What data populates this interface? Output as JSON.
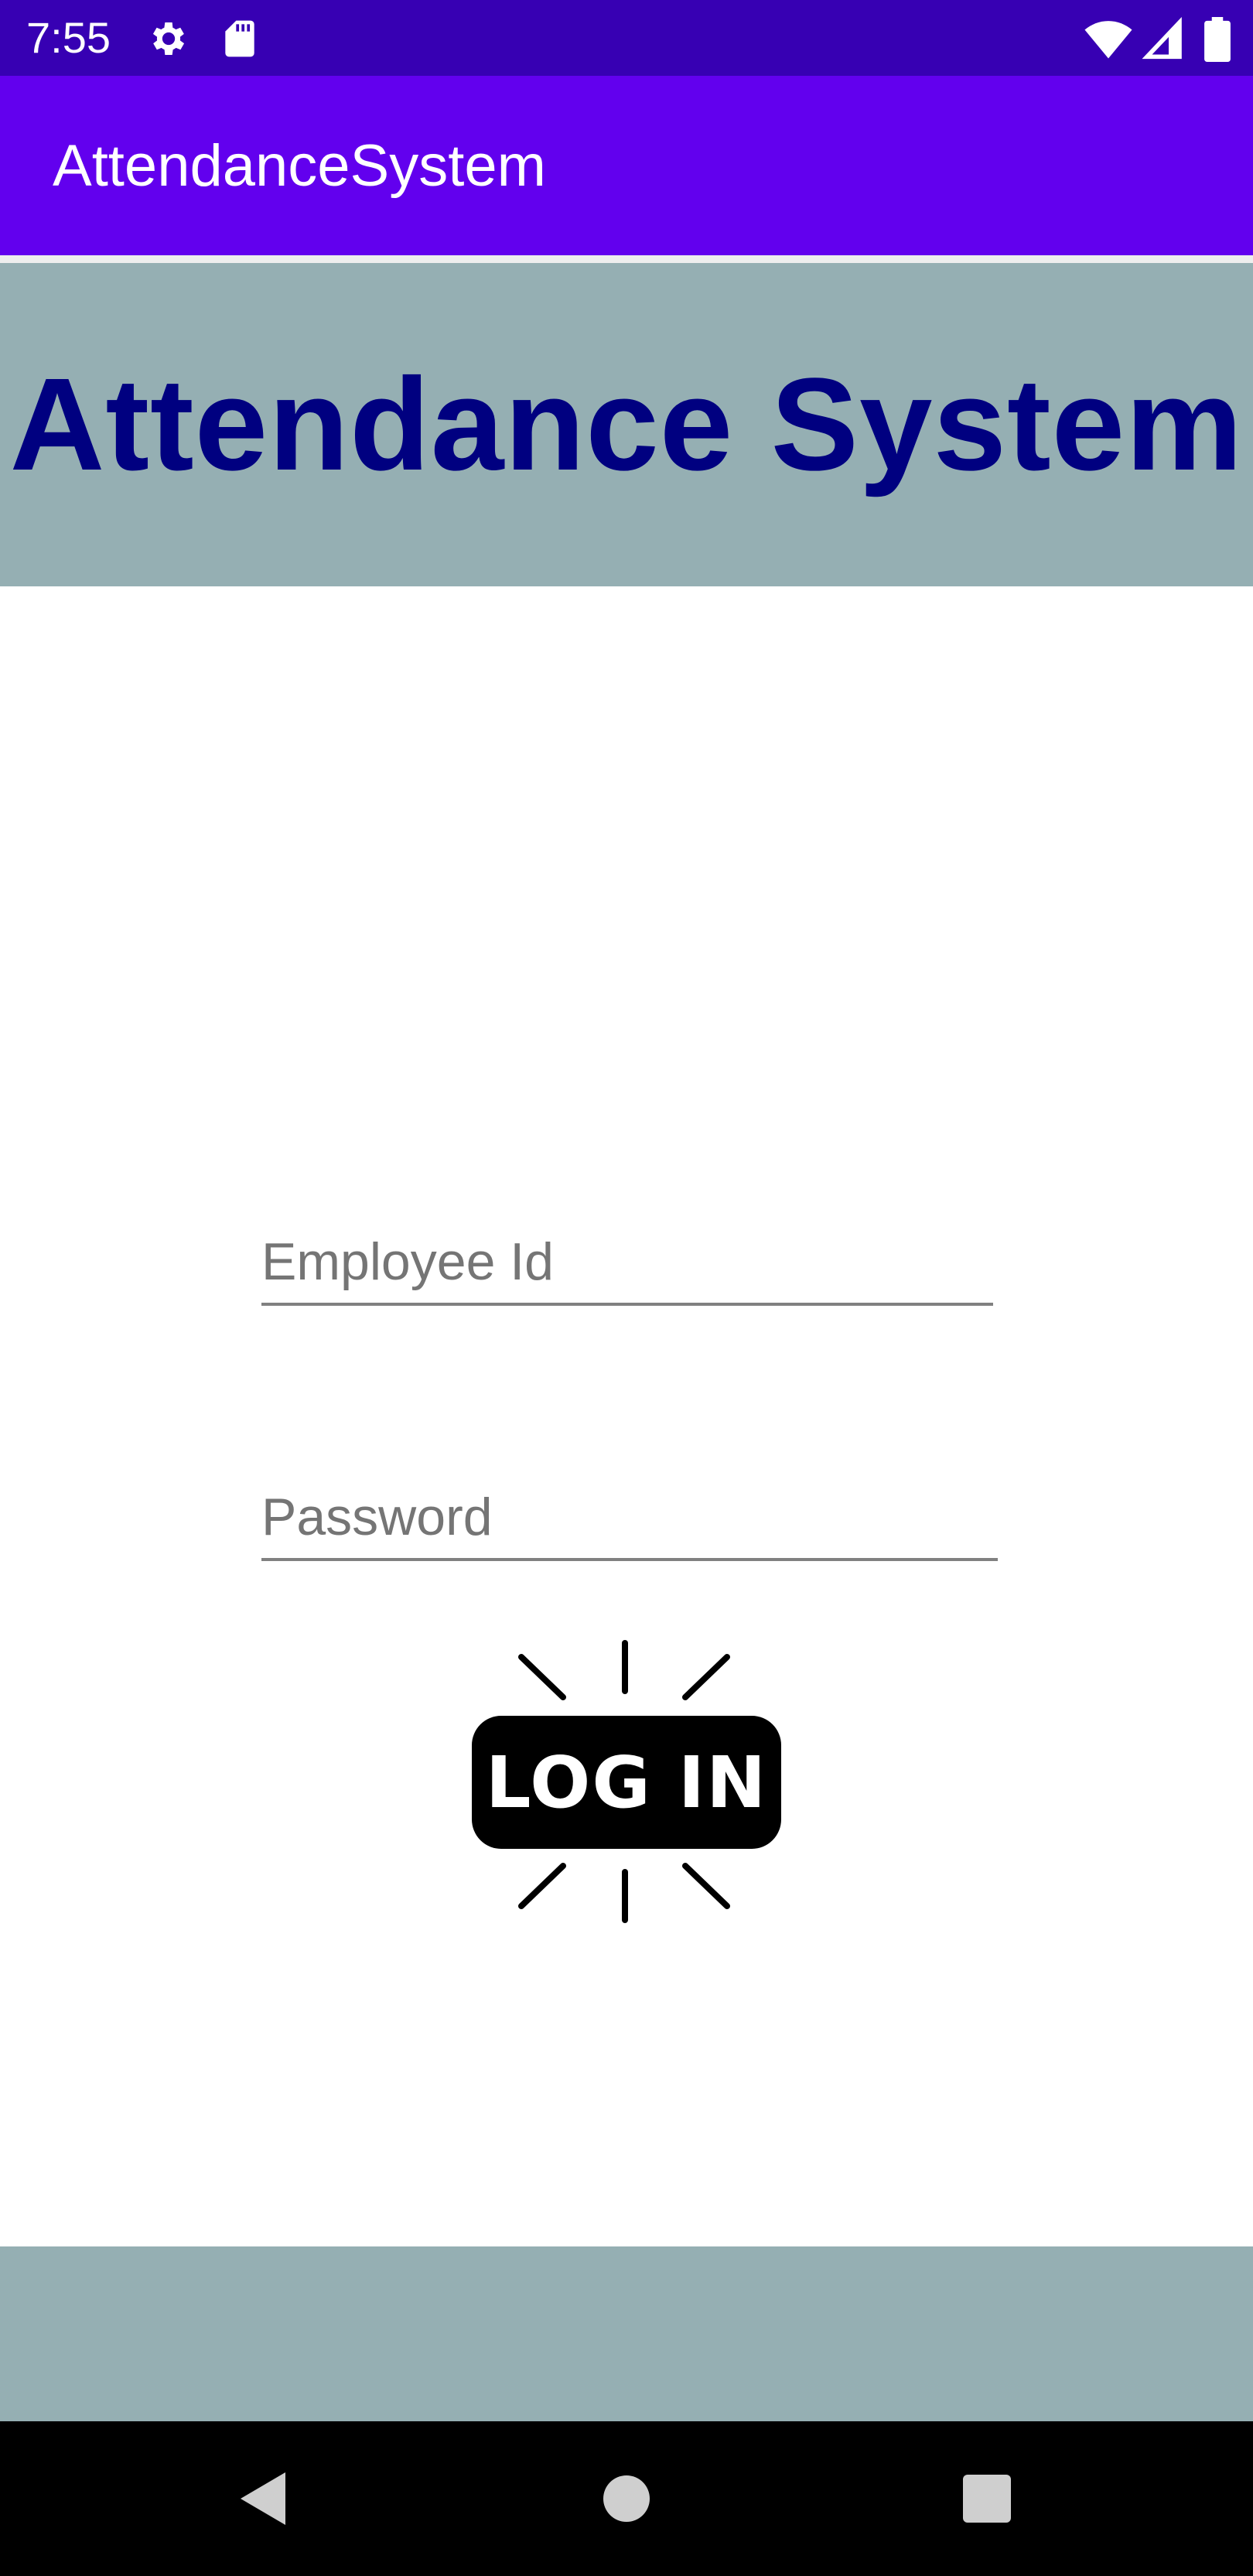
{
  "status_bar": {
    "time": "7:55",
    "icons": [
      "gear-icon",
      "sd-card-icon",
      "wifi-icon",
      "signal-icon",
      "battery-icon"
    ]
  },
  "app_bar": {
    "title": "AttendanceSystem"
  },
  "header": {
    "title": "Attendance System"
  },
  "form": {
    "employee_id": {
      "placeholder": "Employee Id",
      "value": ""
    },
    "password": {
      "placeholder": "Password",
      "value": ""
    },
    "login_label": "LOG IN"
  },
  "nav_bar": {
    "buttons": [
      "back-icon",
      "home-icon",
      "recents-icon"
    ]
  },
  "colors": {
    "status_bar": "#3700b3",
    "app_bar": "#6200ee",
    "banner": "#95afb3",
    "header_text": "#000080",
    "nav_bar": "#000000"
  }
}
